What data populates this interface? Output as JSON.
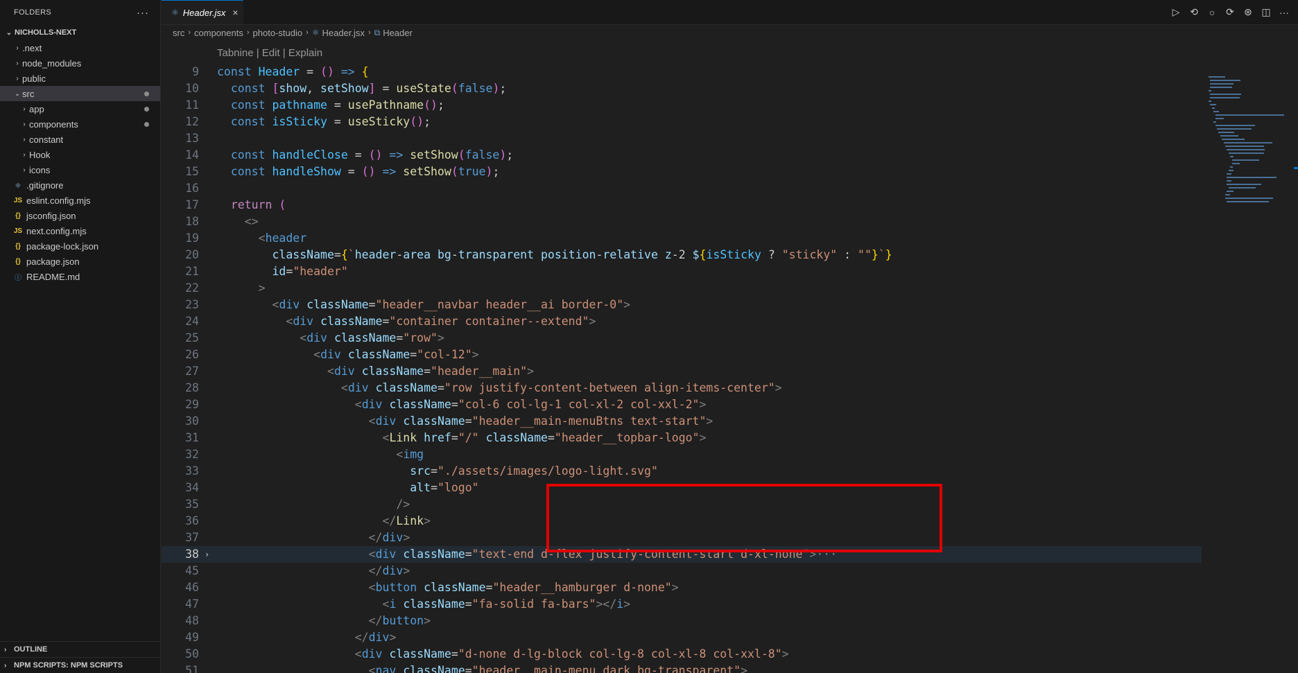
{
  "sidebar": {
    "header": "FOLDERS",
    "more": "···",
    "root": "NICHOLLS-NEXT",
    "items": [
      {
        "label": ".next",
        "type": "folder"
      },
      {
        "label": "node_modules",
        "type": "folder"
      },
      {
        "label": "public",
        "type": "folder"
      },
      {
        "label": "src",
        "type": "folder-open"
      },
      {
        "label": "app",
        "type": "folder"
      },
      {
        "label": "components",
        "type": "folder"
      },
      {
        "label": "constant",
        "type": "folder"
      },
      {
        "label": "Hook",
        "type": "folder"
      },
      {
        "label": "icons",
        "type": "folder"
      },
      {
        "label": ".gitignore",
        "type": "file"
      },
      {
        "label": "eslint.config.mjs",
        "type": "js"
      },
      {
        "label": "jsconfig.json",
        "type": "json"
      },
      {
        "label": "next.config.mjs",
        "type": "js"
      },
      {
        "label": "package-lock.json",
        "type": "json"
      },
      {
        "label": "package.json",
        "type": "json"
      },
      {
        "label": "README.md",
        "type": "info"
      }
    ],
    "outline": "OUTLINE",
    "npm": "NPM SCRIPTS: NPM SCRIPTS",
    "js_icon": "JS",
    "json_icon": "{}",
    "info_icon": "ⓘ",
    "git_icon": "◆"
  },
  "tab": {
    "label": "Header.jsx",
    "close": "×",
    "icon": "⚛"
  },
  "actions": [
    "▷",
    "⟲",
    "○",
    "⟳",
    "⊛",
    "◫",
    "···"
  ],
  "breadcrumb": {
    "parts": [
      "src",
      "components",
      "photo-studio",
      "Header.jsx",
      "Header"
    ],
    "sep": "›"
  },
  "editor": {
    "codelens": "Tabnine | Edit | Explain",
    "current_line": "38",
    "fold_marker": "›",
    "ellipsis": "···",
    "lines": [
      {
        "n": "9",
        "t": "const Header = () => {"
      },
      {
        "n": "10",
        "t": "  const [show, setShow] = useState(false);"
      },
      {
        "n": "11",
        "t": "  const pathname = usePathname();"
      },
      {
        "n": "12",
        "t": "  const isSticky = useSticky();"
      },
      {
        "n": "13",
        "t": ""
      },
      {
        "n": "14",
        "t": "  const handleClose = () => setShow(false);"
      },
      {
        "n": "15",
        "t": "  const handleShow = () => setShow(true);"
      },
      {
        "n": "16",
        "t": ""
      },
      {
        "n": "17",
        "t": "  return ("
      },
      {
        "n": "18",
        "t": "    <>"
      },
      {
        "n": "19",
        "t": "      <header"
      },
      {
        "n": "20",
        "t": "        className={`header-area bg-transparent position-relative z-2 ${isSticky ? \"sticky\" : \"\"}`}"
      },
      {
        "n": "21",
        "t": "        id=\"header\""
      },
      {
        "n": "22",
        "t": "      >"
      },
      {
        "n": "23",
        "t": "        <div className=\"header__navbar header__ai border-0\">"
      },
      {
        "n": "24",
        "t": "          <div className=\"container container--extend\">"
      },
      {
        "n": "25",
        "t": "            <div className=\"row\">"
      },
      {
        "n": "26",
        "t": "              <div className=\"col-12\">"
      },
      {
        "n": "27",
        "t": "                <div className=\"header__main\">"
      },
      {
        "n": "28",
        "t": "                  <div className=\"row justify-content-between align-items-center\">"
      },
      {
        "n": "29",
        "t": "                    <div className=\"col-6 col-lg-1 col-xl-2 col-xxl-2\">"
      },
      {
        "n": "30",
        "t": "                      <div className=\"header__main-menuBtns text-start\">"
      },
      {
        "n": "31",
        "t": "                        <Link href=\"/\" className=\"header__topbar-logo\">"
      },
      {
        "n": "32",
        "t": "                          <img"
      },
      {
        "n": "33",
        "t": "                            src=\"./assets/images/logo-light.svg\""
      },
      {
        "n": "34",
        "t": "                            alt=\"logo\""
      },
      {
        "n": "35",
        "t": "                          />"
      },
      {
        "n": "36",
        "t": "                        </Link>"
      },
      {
        "n": "37",
        "t": "                      </div>"
      },
      {
        "n": "38",
        "t": "                      <div className=\"text-end d-flex justify-content-start d-xl-none\">"
      },
      {
        "n": "45",
        "t": "                      </div>"
      },
      {
        "n": "46",
        "t": "                      <button className=\"header__hamburger d-none\">"
      },
      {
        "n": "47",
        "t": "                        <i className=\"fa-solid fa-bars\"></i>"
      },
      {
        "n": "48",
        "t": "                      </button>"
      },
      {
        "n": "49",
        "t": "                    </div>"
      },
      {
        "n": "50",
        "t": "                    <div className=\"d-none d-lg-block col-lg-8 col-xl-8 col-xxl-8\">"
      },
      {
        "n": "51",
        "t": "                      <nav className=\"header__main-menu dark bg-transparent\">"
      }
    ]
  },
  "colors": {
    "accent": "#0078d4",
    "highlight_box": "#e00000",
    "background": "#1f1f1f"
  }
}
